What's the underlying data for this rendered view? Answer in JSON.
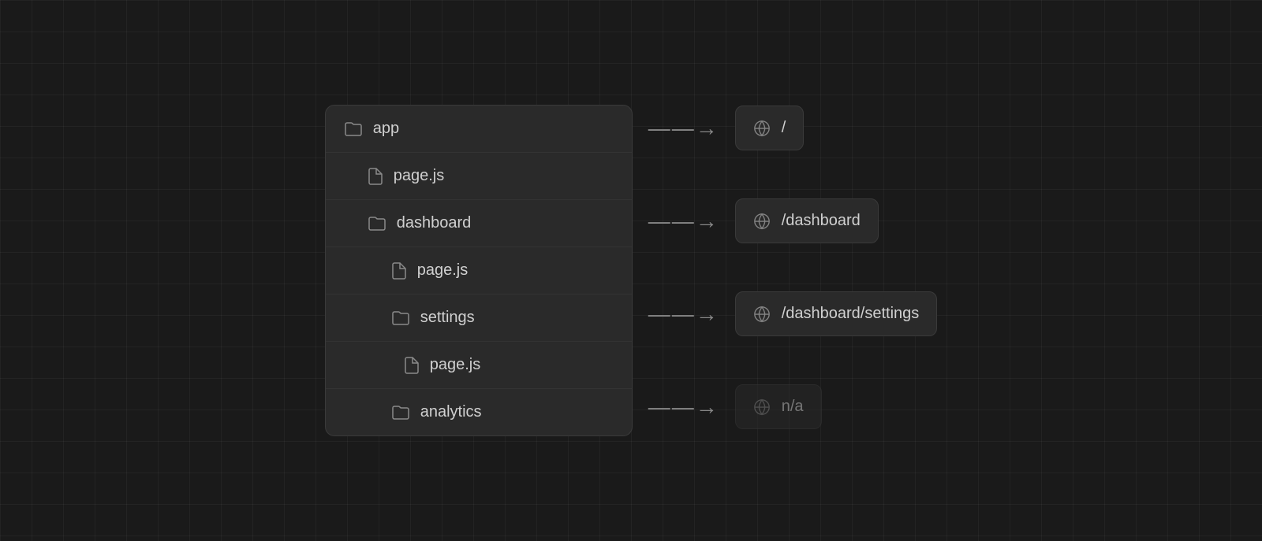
{
  "fileTree": {
    "items": [
      {
        "id": "app",
        "label": "app",
        "type": "folder",
        "level": 1
      },
      {
        "id": "app-page",
        "label": "page.js",
        "type": "file",
        "level": 2
      },
      {
        "id": "dashboard",
        "label": "dashboard",
        "type": "folder",
        "level": 2
      },
      {
        "id": "dashboard-page",
        "label": "page.js",
        "type": "file",
        "level": 3
      },
      {
        "id": "settings",
        "label": "settings",
        "type": "folder",
        "level": 3
      },
      {
        "id": "settings-page",
        "label": "page.js",
        "type": "file",
        "level": 4
      },
      {
        "id": "analytics",
        "label": "analytics",
        "type": "folder",
        "level": 3
      }
    ]
  },
  "routes": [
    {
      "id": "route-root",
      "label": "/",
      "hasArrow": true,
      "dimmed": false
    },
    {
      "id": "route-dashboard",
      "label": "/dashboard",
      "hasArrow": true,
      "dimmed": false
    },
    {
      "id": "route-settings",
      "label": "/dashboard/settings",
      "hasArrow": true,
      "dimmed": false
    },
    {
      "id": "route-analytics",
      "label": "n/a",
      "hasArrow": true,
      "dimmed": true
    }
  ],
  "arrowSymbol": "→"
}
